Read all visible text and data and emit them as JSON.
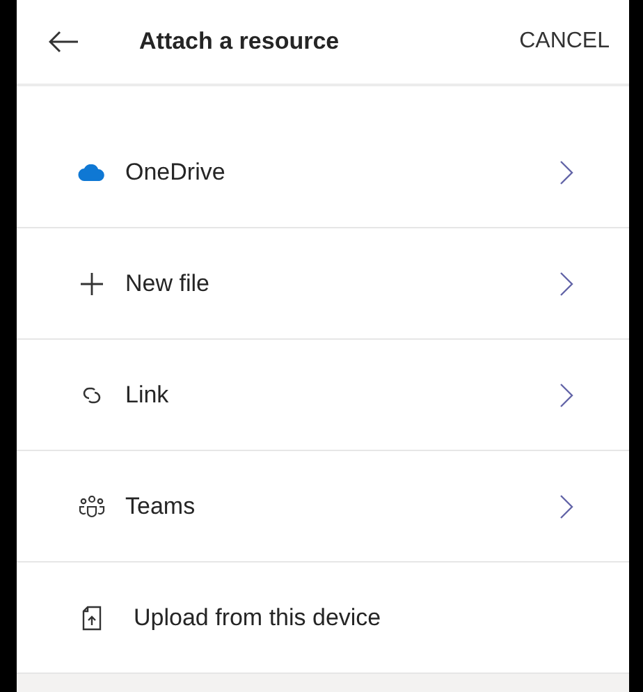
{
  "header": {
    "title": "Attach a resource",
    "cancel": "CANCEL"
  },
  "items": [
    {
      "label": "OneDrive",
      "kind": "submenu"
    },
    {
      "label": "New file",
      "kind": "submenu"
    },
    {
      "label": "Link",
      "kind": "submenu"
    },
    {
      "label": "Teams",
      "kind": "submenu"
    },
    {
      "label": "Upload from this device",
      "kind": "action"
    }
  ]
}
